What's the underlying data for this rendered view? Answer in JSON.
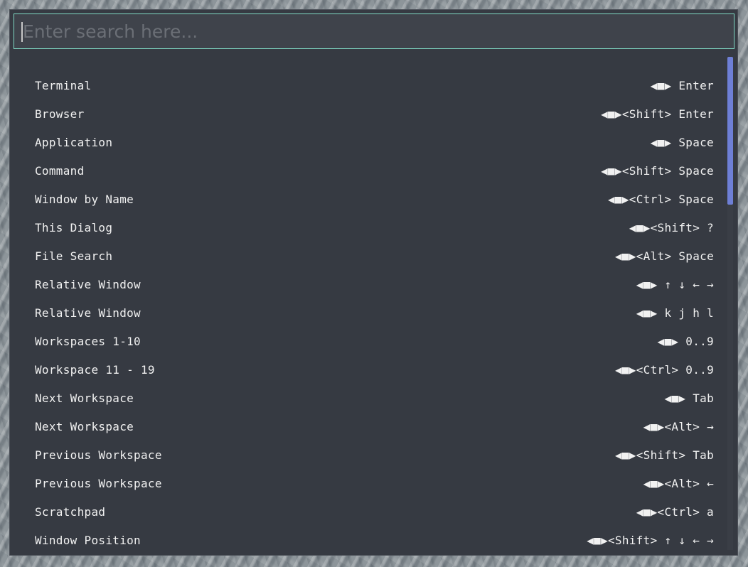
{
  "search": {
    "placeholder": "Enter search here..."
  },
  "shortcuts": [
    {
      "label": "Terminal",
      "keys": "◀■▶ Enter"
    },
    {
      "label": "Browser",
      "keys": "◀■▶<Shift> Enter"
    },
    {
      "label": "Application",
      "keys": "◀■▶ Space"
    },
    {
      "label": "Command",
      "keys": "◀■▶<Shift> Space"
    },
    {
      "label": "Window by Name",
      "keys": "◀■▶<Ctrl> Space"
    },
    {
      "label": "This Dialog",
      "keys": "◀■▶<Shift> ?"
    },
    {
      "label": "File Search",
      "keys": "◀■▶<Alt> Space"
    },
    {
      "label": "Relative Window",
      "keys": "◀■▶ ↑ ↓ ← →"
    },
    {
      "label": "Relative Window",
      "keys": "◀■▶ k j h l"
    },
    {
      "label": "Workspaces 1-10",
      "keys": "◀■▶ 0..9"
    },
    {
      "label": "Workspace 11 - 19",
      "keys": "◀■▶<Ctrl> 0..9"
    },
    {
      "label": "Next Workspace",
      "keys": "◀■▶ Tab"
    },
    {
      "label": "Next Workspace",
      "keys": "◀■▶<Alt> →"
    },
    {
      "label": "Previous Workspace",
      "keys": "◀■▶<Shift> Tab"
    },
    {
      "label": "Previous Workspace",
      "keys": "◀■▶<Alt> ←"
    },
    {
      "label": "Scratchpad",
      "keys": "◀■▶<Ctrl> a"
    },
    {
      "label": "Window Position",
      "keys": "◀■▶<Shift> ↑ ↓ ← →"
    }
  ],
  "scrollbar": {
    "position_fraction": 0.0,
    "visible_fraction": 0.3
  },
  "colors": {
    "dialog_bg": "#363a42",
    "search_border": "#7fd9c4",
    "scroll_thumb": "#6e7fd6",
    "text": "#f1f1f1"
  },
  "icons": {
    "super_key": "super-key-icon"
  }
}
